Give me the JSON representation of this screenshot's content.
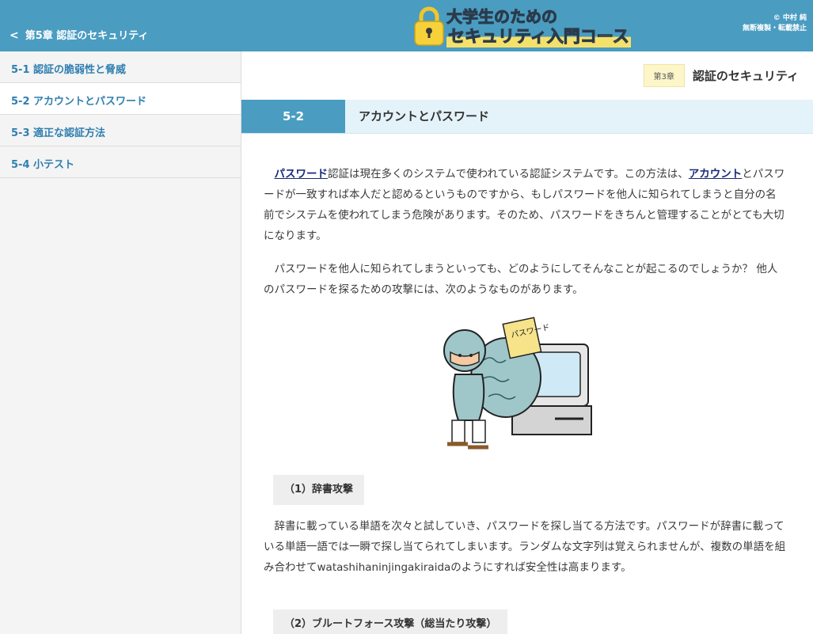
{
  "header": {
    "back_label": "第5章 認証のセキュリティ",
    "logo_line1": "大学生のための",
    "logo_line2": "セキュリティ入門コース",
    "copyright_line1": "© 中村 純",
    "copyright_line2": "無断複製・転載禁止",
    "bg_color": "#4a9cc1"
  },
  "sidebar": {
    "items": [
      {
        "label": "5-1 認証の脆弱性と脅威"
      },
      {
        "label": "5-2 アカウントとパスワード"
      },
      {
        "label": "5-3 適正な認証方法"
      },
      {
        "label": "5-4 小テスト"
      }
    ],
    "active_index": 1
  },
  "main": {
    "chapter_badge": "第3章",
    "chapter_title": "認証のセキュリティ",
    "section_number": "5-2",
    "section_title": "アカウントとパスワード",
    "para1": {
      "link1": "パスワード",
      "text1": "認証は現在多くのシステムで使われている認証システムです。この方法は、",
      "link2": "アカウント",
      "text2": "とパスワードが一致すれば本人だと認めるというものですから、もしパスワードを他人に知られてしまうと自分の名前でシステムを使われてしまう危険があります。そのため、パスワードをきちんと管理することがとても大切になります。"
    },
    "para2": "パスワードを他人に知られてしまうといっても、どのようにしてそんなことが起こるのでしょうか？ 他人のパスワードを探るための攻撃には、次のようなものがあります。",
    "illustration_tag": "パスワード",
    "subhead1": "（1）辞書攻撃",
    "para3": "辞書に載っている単語を次々と試していき、パスワードを探し当てる方法です。パスワードが辞書に載っている単語一語では一瞬で探し当てられてしまいます。ランダムな文字列は覚えられませんが、複数の単語を組み合わせてwatashihaninjingakiraidaのようにすれば安全性は高まります。",
    "subhead2": "（2）ブルートフォース攻撃（総当たり攻撃）"
  }
}
